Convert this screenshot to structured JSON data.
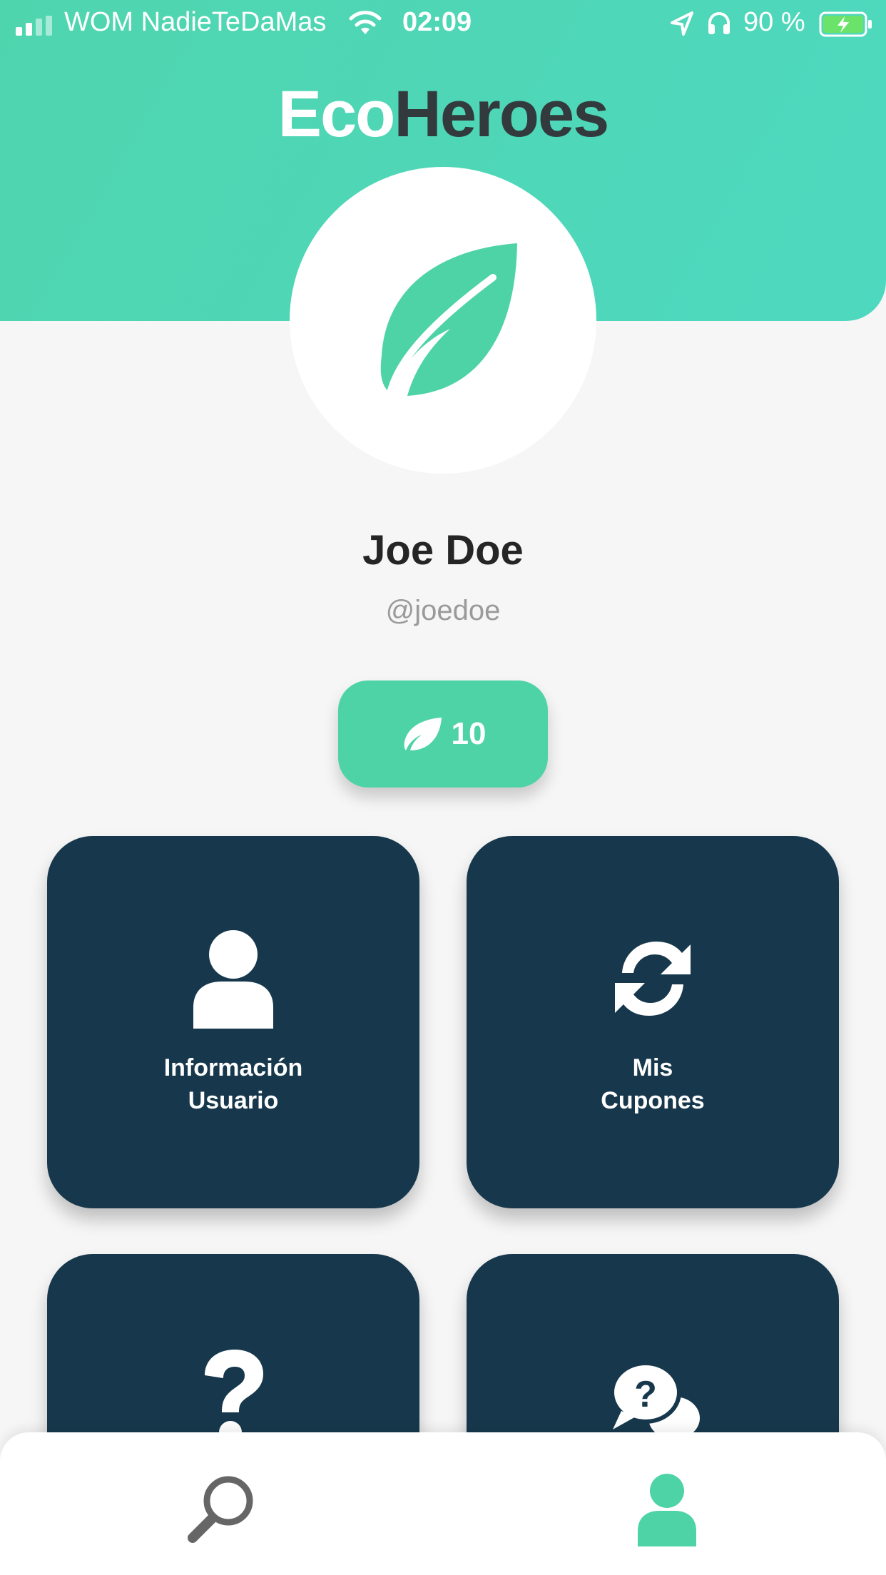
{
  "status_bar": {
    "carrier": "WOM NadieTeDaMas",
    "time": "02:09",
    "battery_percent": "90 %"
  },
  "header": {
    "logo_part1": "Eco",
    "logo_part2": "Heroes"
  },
  "profile": {
    "name": "Joe Doe",
    "handle": "@joedoe",
    "points": "10"
  },
  "cards": [
    {
      "label": "Información\nUsuario",
      "icon": "user-icon"
    },
    {
      "label": "Mis\nCupones",
      "icon": "sync-icon"
    },
    {
      "label": "",
      "icon": "question-icon"
    },
    {
      "label": "",
      "icon": "question-chat-icon"
    }
  ],
  "bottom_nav": {
    "items": [
      {
        "icon": "search-icon",
        "active": false
      },
      {
        "icon": "profile-icon",
        "active": true
      }
    ]
  },
  "colors": {
    "brand_green": "#4dd3a6",
    "card_navy": "#17384c",
    "inactive_icon": "#666666"
  }
}
